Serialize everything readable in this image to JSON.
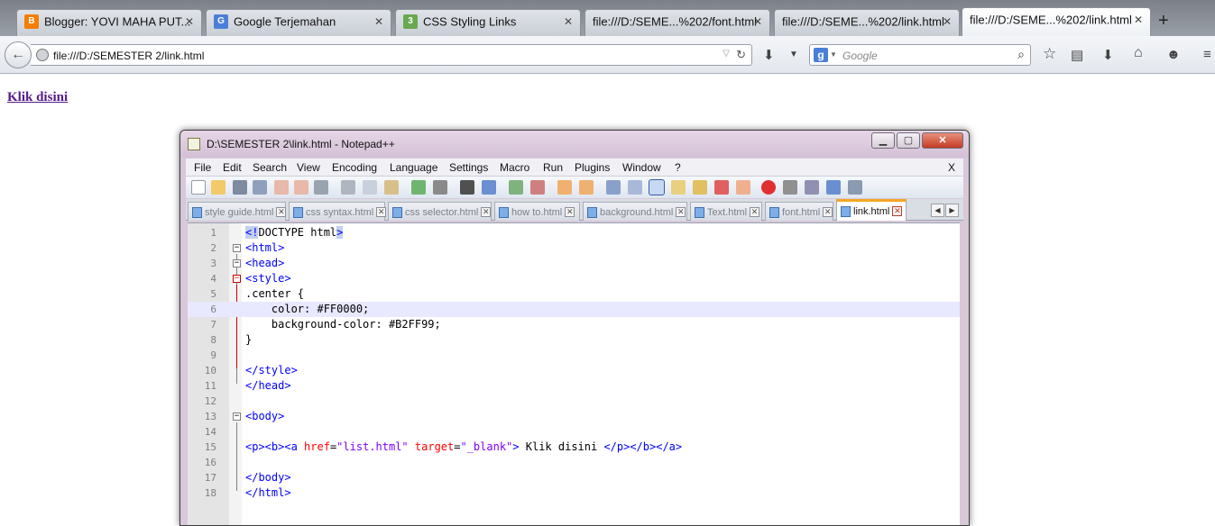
{
  "browser": {
    "tabs": [
      {
        "title": "Blogger: YOVI MAHA PUT...",
        "icon": "blogger-icon",
        "color": "#f57d00"
      },
      {
        "title": "Google Terjemahan",
        "icon": "google-translate-icon",
        "color": "#4a7fd8"
      },
      {
        "title": "CSS Styling Links",
        "icon": "css3-icon",
        "color": "#6aa84f"
      },
      {
        "title": "file:///D:/SEME...%202/font.html",
        "icon": "",
        "color": ""
      },
      {
        "title": "file:///D:/SEME...%202/link.html",
        "icon": "",
        "color": ""
      },
      {
        "title": "file:///D:/SEME...%202/link.html",
        "icon": "",
        "color": ""
      }
    ],
    "url": "file:///D:/SEMESTER 2/link.html",
    "search_placeholder": "Google"
  },
  "page": {
    "link_text": "Klik disini",
    "link_color": "#551a8b"
  },
  "npp": {
    "title": "D:\\SEMESTER 2\\link.html - Notepad++",
    "menu": [
      "File",
      "Edit",
      "Search",
      "View",
      "Encoding",
      "Language",
      "Settings",
      "Macro",
      "Run",
      "Plugins",
      "Window",
      "?"
    ],
    "menu_close": "X",
    "file_tabs": [
      "style guide.html",
      "css syntax.html",
      "css selector.html",
      "how to.html",
      "background.html",
      "Text.html",
      "font.html",
      "link.html"
    ],
    "active_tab": "link.html",
    "line_numbers": [
      "1",
      "2",
      "3",
      "4",
      "5",
      "6",
      "7",
      "8",
      "9",
      "10",
      "11",
      "12",
      "13",
      "14",
      "15",
      "16",
      "17",
      "18"
    ],
    "code": {
      "l1_a": "<!",
      "l1_b": "DOCTYPE html",
      "l1_c": ">",
      "l2": "<html>",
      "l3": "<head>",
      "l4": "<style>",
      "l5": ".center {",
      "l6": "    color: #FF0000;",
      "l7": "    background-color: #B2FF99;",
      "l8": "}",
      "l10": "</style>",
      "l11": "</head>",
      "l13": "<body>",
      "l15_a": "<p><b><a ",
      "l15_b": "href",
      "l15_c": "=",
      "l15_d": "\"list.html\"",
      "l15_e": " ",
      "l15_f": "target",
      "l15_g": "=",
      "l15_h": "\"_blank\"",
      "l15_i": ">",
      "l15_j": " Klik disini ",
      "l15_k": "</p></b></a>",
      "l17": "</body>",
      "l18": "</html>"
    }
  }
}
